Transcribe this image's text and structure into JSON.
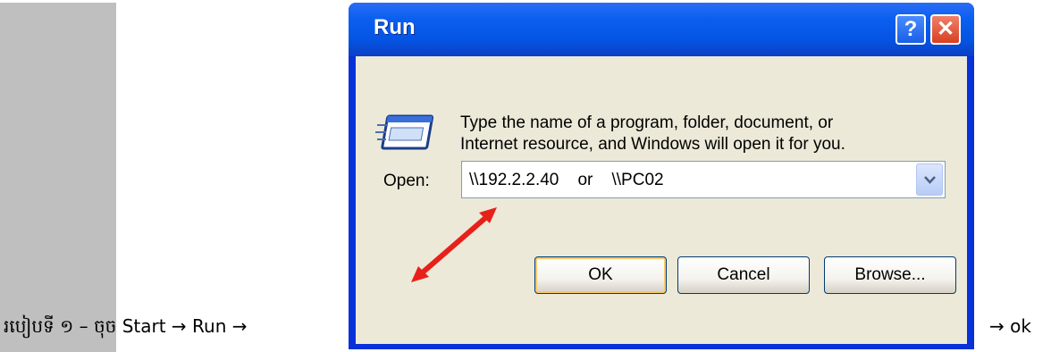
{
  "caption": {
    "prefix": "របៀបទី ១ – ចុច Start → Run →",
    "suffix": "→ ok"
  },
  "dialog": {
    "title": "Run",
    "help_label": "?",
    "close_label": "✕",
    "message_line1": "Type the name of a program, folder, document, or",
    "message_line2": "Internet resource, and Windows will open it for you.",
    "open_label": "Open:",
    "open_value": "\\\\192.2.2.40    or    \\\\PC02",
    "ok_label": "OK",
    "cancel_label": "Cancel",
    "browse_label": "Browse..."
  },
  "colors": {
    "title_bar": "#0554e3",
    "dialog_body": "#ece9d8",
    "annotation_arrow": "#e8201a",
    "side_bar": "#bfbfbf"
  },
  "icons": {
    "dialog_icon": "run-window-icon",
    "combo_icon": "chevron-down-icon",
    "annotation": "red-double-arrow"
  }
}
